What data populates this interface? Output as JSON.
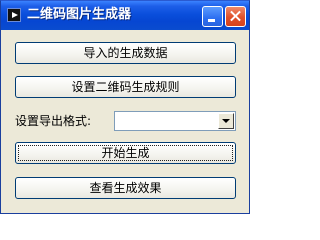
{
  "window": {
    "title": "二维码图片生成器",
    "app_icon": "play-icon",
    "controls": [
      "minimize-icon",
      "close-icon"
    ]
  },
  "buttons": {
    "import_data": "导入的生成数据",
    "set_rules": "设置二维码生成规则",
    "start": "开始生成",
    "view_results": "查看生成效果"
  },
  "export_format": {
    "label": "设置导出格式:",
    "selected": ""
  },
  "colors": {
    "title_bar": "#0a4fdc",
    "window_bg": "#ece9d8",
    "close_button": "#e0502a"
  }
}
